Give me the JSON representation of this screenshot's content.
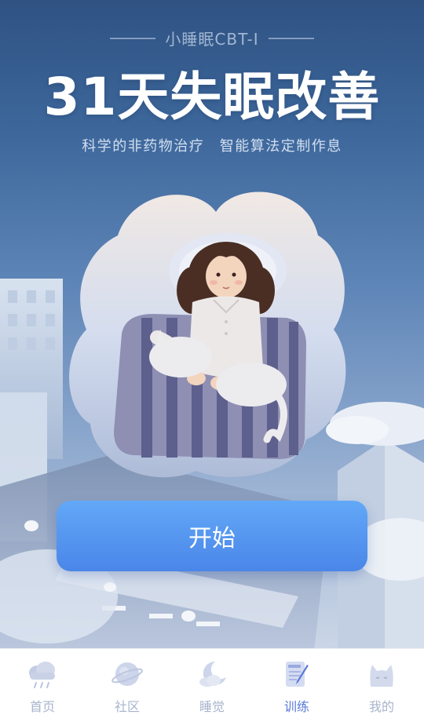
{
  "brand": "小睡眠CBT-I",
  "headline": "31天失眠改善",
  "subtitle": "科学的非药物治疗　智能算法定制作息",
  "start_button": "开始",
  "tabs": [
    {
      "label": "首页",
      "icon": "cloud-rain-icon",
      "active": false
    },
    {
      "label": "社区",
      "icon": "planet-icon",
      "active": false
    },
    {
      "label": "睡觉",
      "icon": "moon-cloud-icon",
      "active": false
    },
    {
      "label": "训练",
      "icon": "notebook-pen-icon",
      "active": true
    },
    {
      "label": "我的",
      "icon": "cat-face-icon",
      "active": false
    }
  ],
  "colors": {
    "accent": "#4a86e8",
    "active_tab": "#5a7bd8",
    "inactive_tab": "#a8b4cc"
  }
}
